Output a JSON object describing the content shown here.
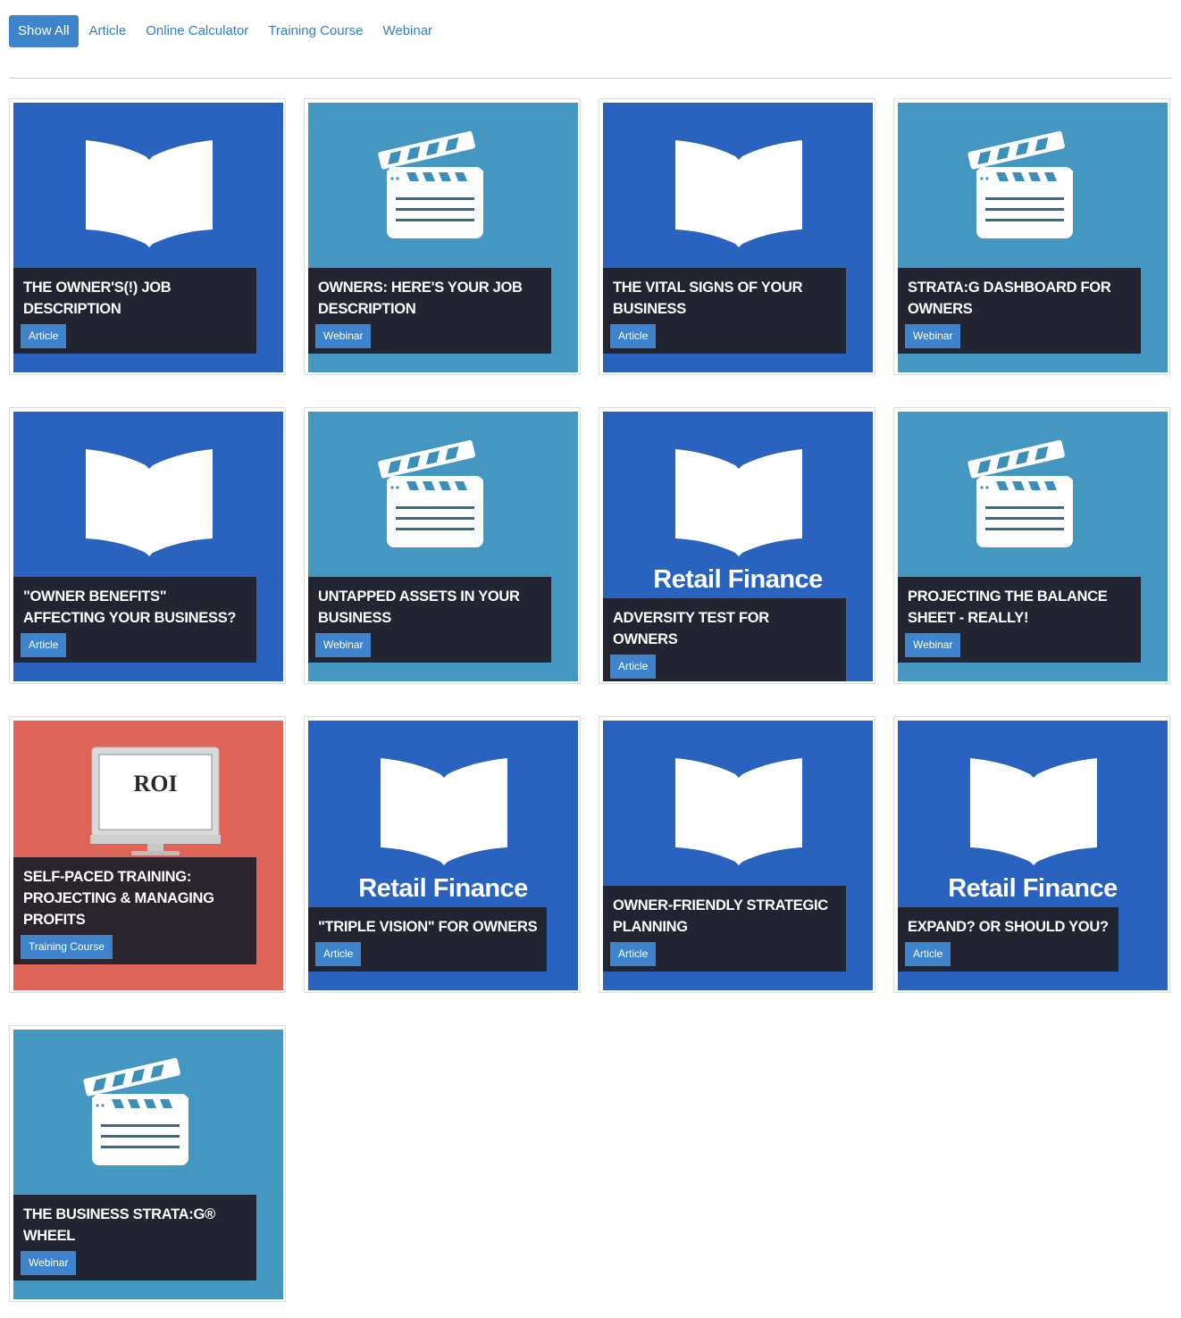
{
  "filters": [
    {
      "label": "Show All",
      "active": true
    },
    {
      "label": "Article",
      "active": false
    },
    {
      "label": "Online Calculator",
      "active": false
    },
    {
      "label": "Training Course",
      "active": false
    },
    {
      "label": "Webinar",
      "active": false
    }
  ],
  "colors": {
    "article_bg": "#2a62bf",
    "webinar_bg": "#4397c1",
    "training_bg": "#df6458",
    "tag_bg": "#3d84cc",
    "overlay_bg": "#22212c"
  },
  "cards": [
    {
      "title": "The Owner'S(!) Job Description",
      "category": "Article",
      "icon": "open-book-icon"
    },
    {
      "title": "Owners: Here'S Your Job Description",
      "category": "Webinar",
      "icon": "clapperboard-icon"
    },
    {
      "title": "The Vital Signs Of Your Business",
      "category": "Article",
      "icon": "open-book-icon"
    },
    {
      "title": "Strata:G Dashboard For Owners",
      "category": "Webinar",
      "icon": "clapperboard-icon"
    },
    {
      "title": "\"Owner Benefits\" Affecting Your Business?",
      "category": "Article",
      "icon": "open-book-icon"
    },
    {
      "title": "Untapped Assets In Your Business",
      "category": "Webinar",
      "icon": "clapperboard-icon"
    },
    {
      "title": "Adversity Test For Owners",
      "category": "Article",
      "icon": "open-book-icon",
      "caption": "Retail Finance"
    },
    {
      "title": "Projecting The Balance Sheet - Really!",
      "category": "Webinar",
      "icon": "clapperboard-icon"
    },
    {
      "title": "Self-Paced Training: Projecting & Managing Profits",
      "category": "Training Course",
      "icon": "monitor-icon",
      "screen_text": "ROI"
    },
    {
      "title": "\"Triple Vision\" For Owners",
      "category": "Article",
      "icon": "open-book-icon",
      "caption": "Retail Finance"
    },
    {
      "title": "Owner-Friendly Strategic Planning",
      "category": "Article",
      "icon": "open-book-icon"
    },
    {
      "title": "Expand? Or Should You?",
      "category": "Article",
      "icon": "open-book-icon",
      "caption": "Retail Finance"
    },
    {
      "title": "The Business Strata:G® Wheel",
      "category": "Webinar",
      "icon": "clapperboard-icon"
    }
  ]
}
